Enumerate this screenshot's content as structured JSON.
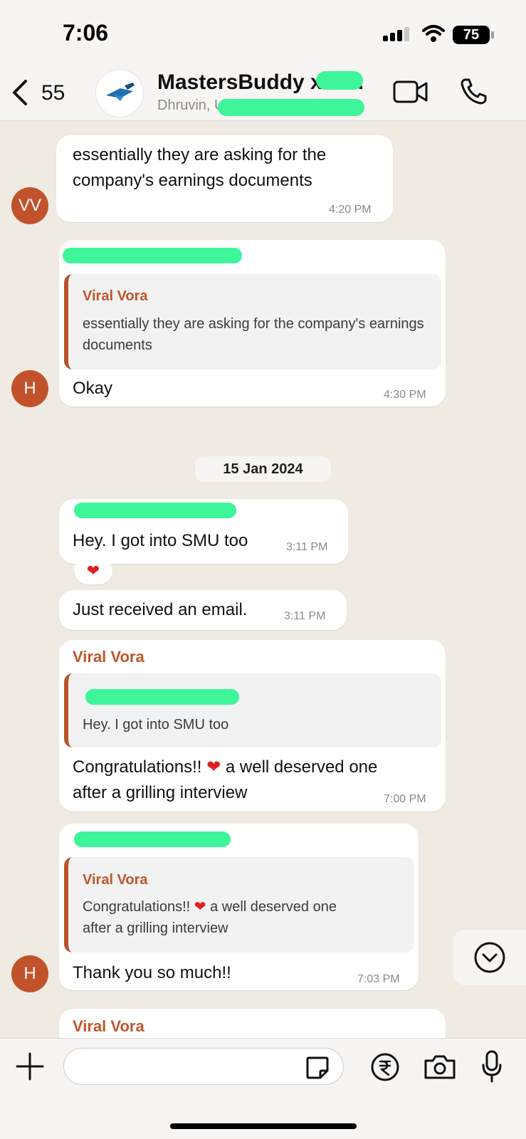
{
  "status_bar": {
    "time": "7:06",
    "battery": "75"
  },
  "header": {
    "back_count": "55",
    "group_name": "MastersBuddy x·····.",
    "group_members": "Dhruvin, U"
  },
  "messages": [
    {
      "text": "essentially they are asking for the company's earnings documents",
      "time": "4:20 PM",
      "avatar": "VV"
    },
    {
      "quote_name": "Viral Vora",
      "quote_text": "essentially they are asking for the company's earnings documents",
      "text": "Okay",
      "time": "4:30 PM",
      "avatar": "H"
    },
    {
      "date": "15 Jan 2024"
    },
    {
      "text": "Hey. I got into SMU too",
      "time": "3:11 PM",
      "reaction": "❤"
    },
    {
      "text": "Just received an email.",
      "time": "3:11 PM"
    },
    {
      "sender": "Viral Vora",
      "quote_text": "Hey. I got into SMU too",
      "text_a": "Congratulations!! ",
      "text_b": " a well deserved one",
      "text_c": "after a grilling interview",
      "time": "7:00 PM"
    },
    {
      "quote_name": "Viral Vora",
      "quote_text_a": "Congratulations!! ",
      "quote_text_b": " a well deserved one",
      "quote_text_c": "after a grilling interview",
      "text": "Thank you so much!!",
      "time": "7:03 PM",
      "avatar": "H"
    },
    {
      "sender": "Viral Vora"
    }
  ],
  "composer": {
    "placeholder": ""
  },
  "colors": {
    "accent": "#c0562c",
    "redaction": "#3ef59a",
    "background": "#efeae2"
  },
  "icons": [
    "back-chevron-icon",
    "video-call-icon",
    "phone-call-icon",
    "plus-icon",
    "sticker-icon",
    "rupee-icon",
    "camera-icon",
    "microphone-icon",
    "chevron-down-icon"
  ]
}
